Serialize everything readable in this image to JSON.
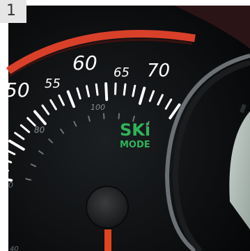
{
  "figure_number": "1",
  "dial": {
    "major_labels": [
      "50",
      "60",
      "70"
    ],
    "minor_labels": [
      "55",
      "65"
    ],
    "inner_labels": [
      "80",
      "100"
    ],
    "edge_label": "0",
    "bottom_edge_label": "40"
  },
  "indicator": {
    "line1": "SKi",
    "line2": "MODE",
    "color": "#2fb35a"
  },
  "colors": {
    "redline": "#d9402a",
    "needle": "#e0451f",
    "dial_face": "#101214",
    "lcd": "#d2dcd6"
  }
}
